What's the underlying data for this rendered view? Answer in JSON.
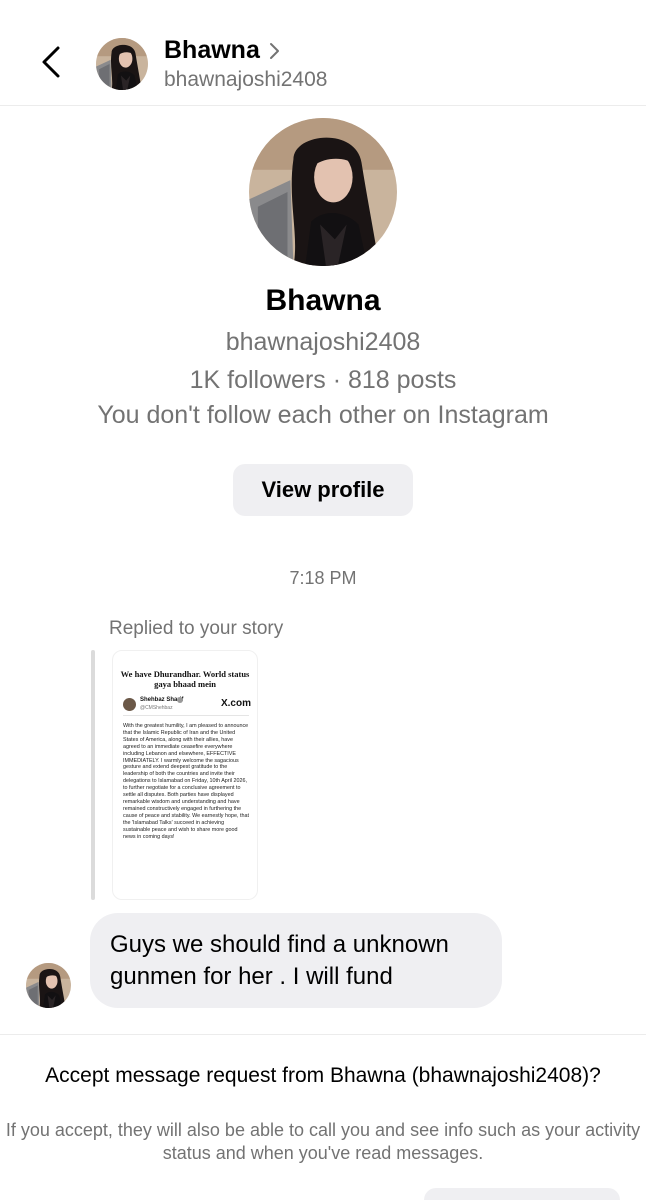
{
  "header": {
    "name": "Bhawna",
    "username": "bhawnajoshi2408"
  },
  "profile": {
    "name": "Bhawna",
    "username": "bhawnajoshi2408",
    "stats": "1K followers · 818 posts",
    "follow_status": "You don't follow each other on Instagram",
    "view_profile_label": "View profile"
  },
  "conversation": {
    "timestamp": "7:18 PM",
    "replied_label": "Replied to your story",
    "story": {
      "title": "We have Dhurandhar. World status gaya bhaad mein",
      "tweet_name": "Shehbaz Sharif",
      "tweet_handle": "@CMShehbaz",
      "tweet_source": "X.com",
      "tweet_text": "With the greatest humility, I am pleased to announce that the Islamic Republic of Iran and the United States of America, along with their allies, have agreed to an immediate ceasefire everywhere including Lebanon and elsewhere, EFFECTIVE IMMEDIATELY. I warmly welcome the sagacious gesture and extend deepest gratitude to the leadership of both the countries and invite their delegations to Islamabad on Friday, 10th April 2026, to further negotiate for a conclusive agreement to settle all disputes. Both parties have displayed remarkable wisdom and understanding and have remained constructively engaged in furthering the cause of peace and stability. We earnestly hope, that the 'Islamabad Talks' succeed in achieving sustainable peace and wish to share more good news in coming days!"
    },
    "message": {
      "text": "Guys we should find a unknown gunmen for her . I will fund"
    }
  },
  "request": {
    "title": "Accept message request from Bhawna (bhawnajoshi2408)?",
    "description": "If you accept, they will also be able to call you and see info such as your activity status and when you've read messages."
  },
  "icons": {
    "back": "chevron-left-icon",
    "header_chevron": "chevron-right-icon",
    "verified": "verified-badge-icon"
  },
  "colors": {
    "secondary_text": "#737373",
    "bubble_bg": "#efeff2",
    "divider": "#ececec"
  }
}
